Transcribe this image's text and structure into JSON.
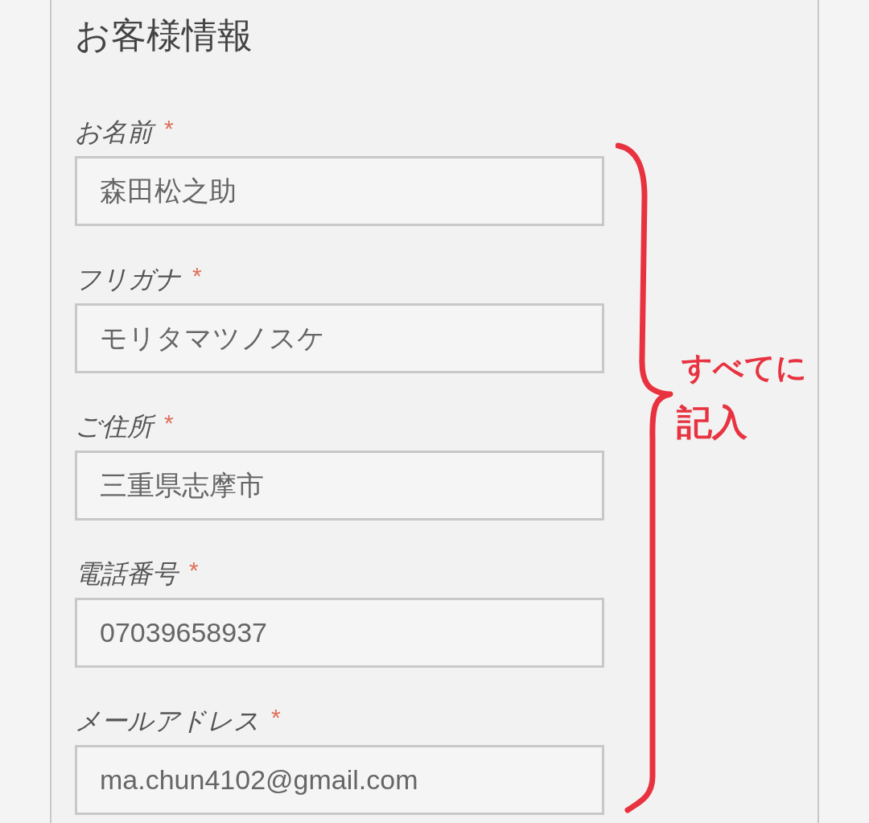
{
  "section": {
    "title": "お客様情報"
  },
  "fields": [
    {
      "label": "お名前",
      "required_mark": "*",
      "value": "森田松之助"
    },
    {
      "label": "フリガナ",
      "required_mark": "*",
      "value": "モリタマツノスケ"
    },
    {
      "label": "ご住所",
      "required_mark": "*",
      "value": "三重県志摩市"
    },
    {
      "label": "電話番号",
      "required_mark": "*",
      "value": "07039658937"
    },
    {
      "label": "メールアドレス",
      "required_mark": "*",
      "value": "ma.chun4102@gmail.com"
    }
  ],
  "annotation": {
    "lines": [
      "すべてに",
      "記入"
    ]
  }
}
